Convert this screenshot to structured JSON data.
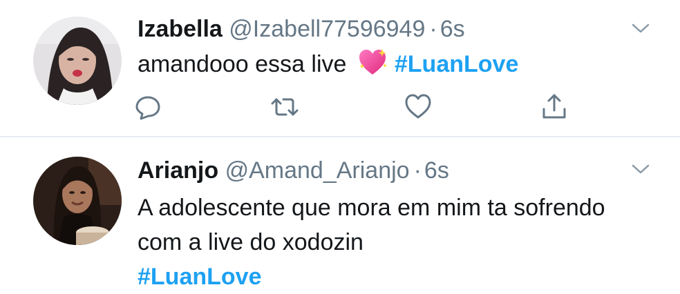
{
  "colors": {
    "text": "#14171a",
    "secondary": "#657786",
    "hashtag": "#1da1f2",
    "divider": "#e6ecf0",
    "heart_emoji": "#ee4f9c"
  },
  "tweets": [
    {
      "name": "Izabella",
      "handle": "@Izabell77596949",
      "separator": "·",
      "time": "6s",
      "text": "amandooo essa live",
      "emoji": "sparkling-heart-icon",
      "hashtag": "#LuanLove",
      "actions": [
        "reply-icon",
        "retweet-icon",
        "like-icon",
        "share-icon"
      ]
    },
    {
      "name": "Arianjo",
      "handle": "@Amand_Arianjo",
      "separator": "·",
      "time": "6s",
      "text": "A adolescente que mora em mim ta sofrendo com a live do xodozin",
      "hashtag": "#LuanLove"
    }
  ]
}
